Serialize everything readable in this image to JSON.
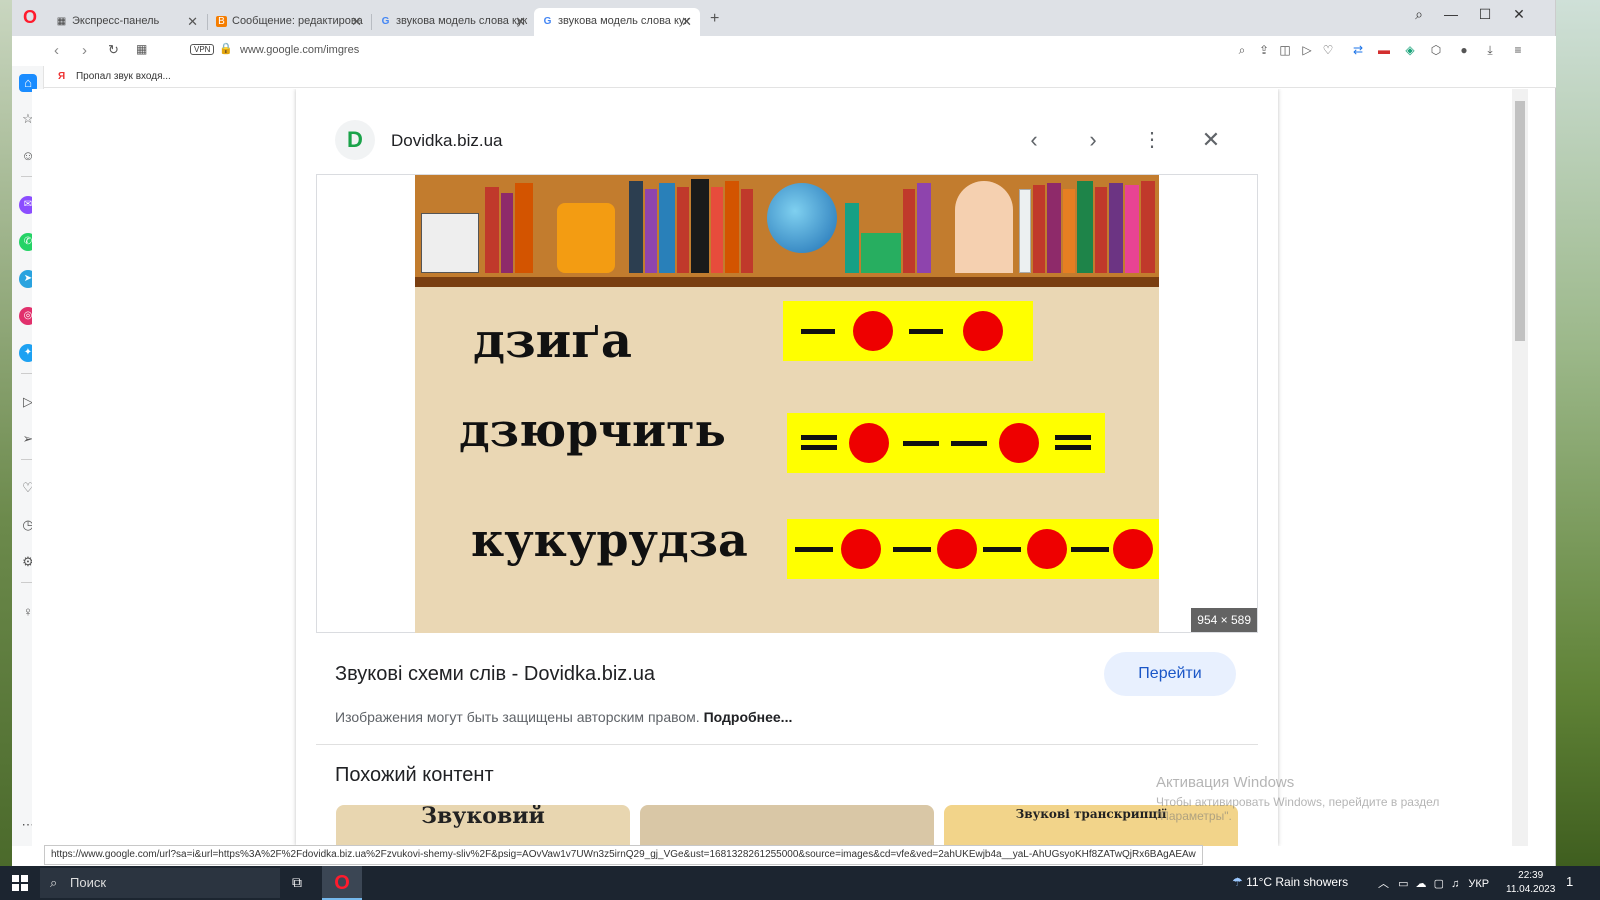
{
  "tabs": [
    {
      "label": "Экспресс-панель",
      "icon": "grid-icon"
    },
    {
      "label": "Сообщение: редактирова",
      "icon": "blogger-icon"
    },
    {
      "label": "звукова модель слова кук",
      "icon": "google-icon"
    },
    {
      "label": "звукова модель слова кук",
      "icon": "google-icon",
      "active": true
    }
  ],
  "address": {
    "vpn": "VPN",
    "url": "www.google.com/imgres"
  },
  "bookmarks": [
    {
      "label": "Пропал звук входя..."
    }
  ],
  "panel": {
    "source_logo": "D",
    "source_name": "Dovidka.biz.ua",
    "image_dims": "954 × 589",
    "result_title": "Звукові схеми слів - Dovidka.biz.ua",
    "goto_label": "Перейти",
    "copyright_text": "Изображения могут быть защищены авторским правом.",
    "copyright_more": "Подробнее...",
    "similar_title": "Похожий контент"
  },
  "preview": {
    "words": [
      "дзиґа",
      "дзюрчить",
      "кукурудза"
    ]
  },
  "thumbs": [
    {
      "label": "Звуковий"
    },
    {
      "label": ""
    },
    {
      "label": "Звукові транскрипції"
    }
  ],
  "watermark": {
    "line1": "Активация Windows",
    "line2": "Чтобы активировать Windows, перейдите в раздел \"Параметры\"."
  },
  "status_url": "https://www.google.com/url?sa=i&url=https%3A%2F%2Fdovidka.biz.ua%2Fzvukovi-shemy-sliv%2F&psig=AOvVaw1v7UWn3z5irnQ29_gj_VGe&ust=1681328261255000&source=images&cd=vfe&ved=2ahUKEwjb4a__yaL-AhUGsyoKHf8ZATwQjRx6BAgAEAw",
  "taskbar": {
    "search_placeholder": "Поиск",
    "weather": "11°C  Rain showers",
    "lang": "УКР",
    "time": "22:39",
    "date": "11.04.2023",
    "notif_count": "1"
  },
  "colors": {
    "accent": "#1a56c7",
    "opera_red": "#ff1b2d",
    "scheme_yellow": "#ffff00",
    "vowel_red": "#e00000"
  }
}
